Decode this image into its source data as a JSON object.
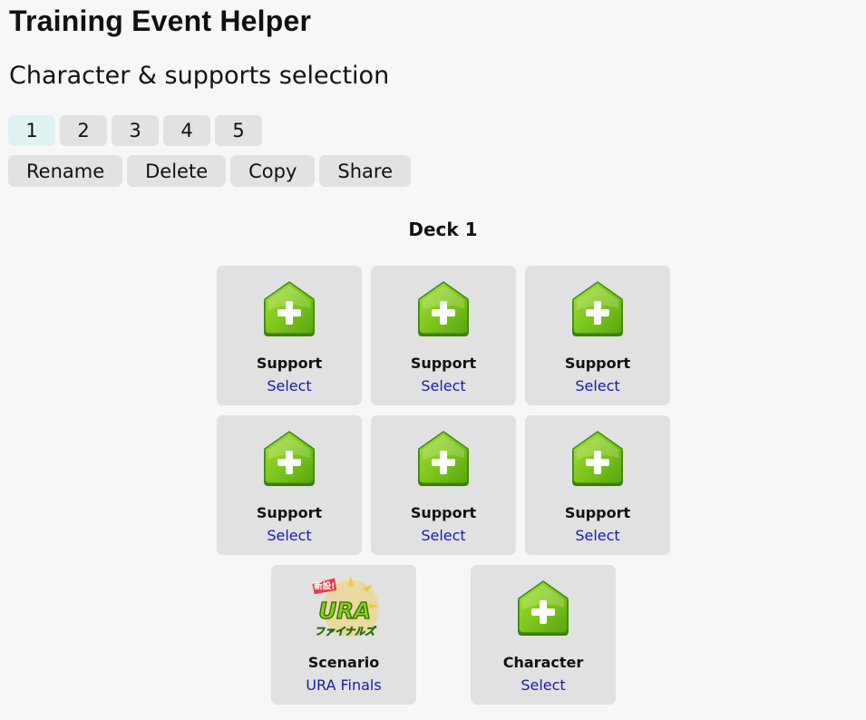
{
  "app": {
    "title": "Training Event Helper",
    "subtitle": "Character & supports selection"
  },
  "deck_tabs": [
    {
      "label": "1",
      "active": true
    },
    {
      "label": "2",
      "active": false
    },
    {
      "label": "3",
      "active": false
    },
    {
      "label": "4",
      "active": false
    },
    {
      "label": "5",
      "active": false
    }
  ],
  "actions": {
    "rename": "Rename",
    "delete": "Delete",
    "copy": "Copy",
    "share": "Share"
  },
  "deck": {
    "title": "Deck 1",
    "supports": [
      {
        "label": "Support",
        "link": "Select",
        "icon": "add-icon"
      },
      {
        "label": "Support",
        "link": "Select",
        "icon": "add-icon"
      },
      {
        "label": "Support",
        "link": "Select",
        "icon": "add-icon"
      },
      {
        "label": "Support",
        "link": "Select",
        "icon": "add-icon"
      },
      {
        "label": "Support",
        "link": "Select",
        "icon": "add-icon"
      },
      {
        "label": "Support",
        "link": "Select",
        "icon": "add-icon"
      }
    ],
    "scenario": {
      "label": "Scenario",
      "link": "URA Finals",
      "icon": "ura-finals-logo",
      "logo_text": "URA",
      "logo_sub": "ファイナルズ",
      "logo_badge": "新設!"
    },
    "character": {
      "label": "Character",
      "link": "Select",
      "icon": "add-icon"
    }
  },
  "colors": {
    "background": "#f7f7f7",
    "card": "#e1e1e1",
    "button": "#e2e2e2",
    "active_tab": "#e0f3f3",
    "link": "#1a1aa6",
    "icon_green": "#7ac51a"
  }
}
